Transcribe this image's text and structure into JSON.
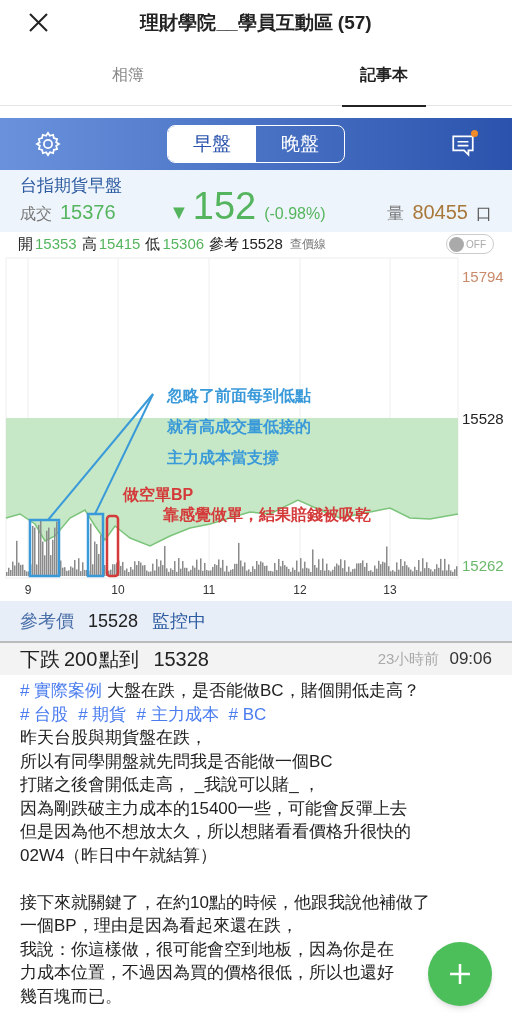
{
  "header": {
    "title": "理財學院__學員互動區 (57)"
  },
  "tabs": [
    {
      "label": "相簿",
      "selected": false
    },
    {
      "label": "記事本",
      "selected": true
    }
  ],
  "quote_panel": {
    "sessions": [
      {
        "label": "早盤",
        "selected": true
      },
      {
        "label": "晚盤",
        "selected": false
      }
    ],
    "message_unread": true,
    "name": "台指期貨早盤",
    "trade_label": "成交",
    "trade_value": "15376",
    "change_arrow": "▼",
    "change": "152",
    "change_pct": "(-0.98%)",
    "volume_label": "量",
    "volume_value": "80455",
    "volume_unit": "口",
    "ohlc": [
      {
        "label": "開",
        "value": "15353"
      },
      {
        "label": "高",
        "value": "15415"
      },
      {
        "label": "低",
        "value": "15306"
      },
      {
        "label": "參考",
        "value": "15528"
      }
    ],
    "price_line_label": "查價線",
    "price_line_toggle": {
      "label": "OFF",
      "on": false
    },
    "chart": {
      "y_labels": [
        "15794",
        "15528",
        "15262"
      ],
      "x_labels": [
        "9",
        "10",
        "11",
        "12",
        "13"
      ],
      "note_blue": [
        "忽略了前面每到低點",
        "就有高成交量低接的",
        "主力成本當支撐"
      ],
      "note_red": [
        "做空單BP",
        "靠感覺做單，結果賠錢被吸乾"
      ]
    },
    "reference": {
      "label": "參考價",
      "value": "15528",
      "status": "監控中"
    },
    "alert": {
      "text": "下跌",
      "points": "200",
      "unit": "點到",
      "target": "15328",
      "ago": "23小時前",
      "time": "09:06"
    }
  },
  "post": {
    "title_tag": "# 實際案例",
    "title": "大盤在跌，是否能做BC，賭個開低走高？",
    "tags": [
      "# 台股",
      "# 期貨",
      "# 主力成本",
      "# BC"
    ],
    "paragraphs": [
      [
        "昨天台股與期貨盤在跌，",
        "所以有同學開盤就先問我是否能做一個BC",
        "打賭之後會開低走高， _我說可以賭_ ，",
        "因為剛跌破主力成本的15400一些，可能會反彈上去",
        "但是因為他不想放太久，所以想賭看看價格升很快的",
        "02W4（昨日中午就結算）"
      ],
      [
        "接下來就關鍵了，在約10點的時候，他跟我說他補做了",
        "一個BP，理由是因為看起來還在跌，",
        "我說：你這樣做，很可能會空到地板，因為你是在",
        "力成本位置，不過因為買的價格很低，所以也還好",
        "幾百塊而已。"
      ]
    ]
  }
}
